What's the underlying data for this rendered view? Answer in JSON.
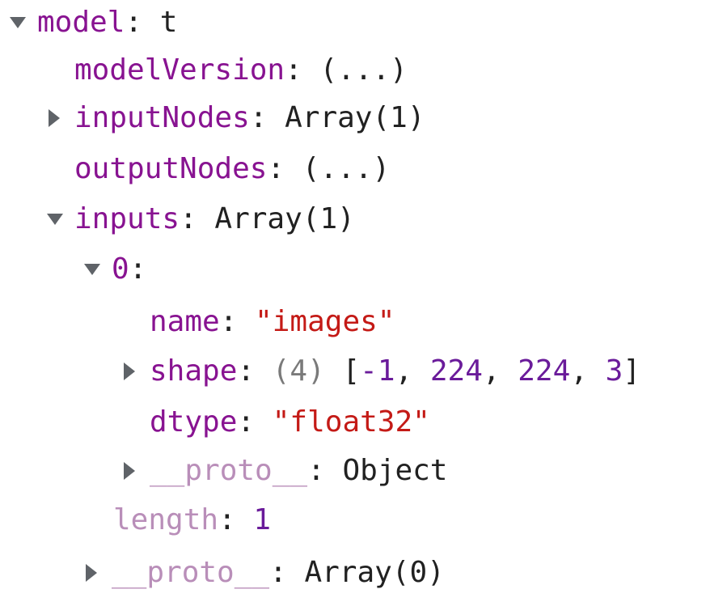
{
  "tree": {
    "model": {
      "key": "model",
      "value": "t"
    },
    "modelVersion": {
      "key": "modelVersion",
      "value": "(...)"
    },
    "inputNodes": {
      "key": "inputNodes",
      "value": "Array(1)"
    },
    "outputNodes": {
      "key": "outputNodes",
      "value": "(...)"
    },
    "inputs": {
      "key": "inputs",
      "value": "Array(1)"
    },
    "item0": {
      "key": "0"
    },
    "name": {
      "key": "name",
      "value": "images"
    },
    "shape": {
      "key": "shape",
      "count": "(4)",
      "values": [
        "-1",
        "224",
        "224",
        "3"
      ]
    },
    "dtype": {
      "key": "dtype",
      "value": "float32"
    },
    "proto_inner": {
      "key": "__proto__",
      "value": "Object"
    },
    "length": {
      "key": "length",
      "value": "1"
    },
    "proto_outer": {
      "key": "__proto__",
      "value": "Array(0)"
    }
  },
  "colors": {
    "key": "#881391",
    "string": "#c41a16",
    "number": "#1c00cf",
    "arrow": "#5f6368"
  }
}
